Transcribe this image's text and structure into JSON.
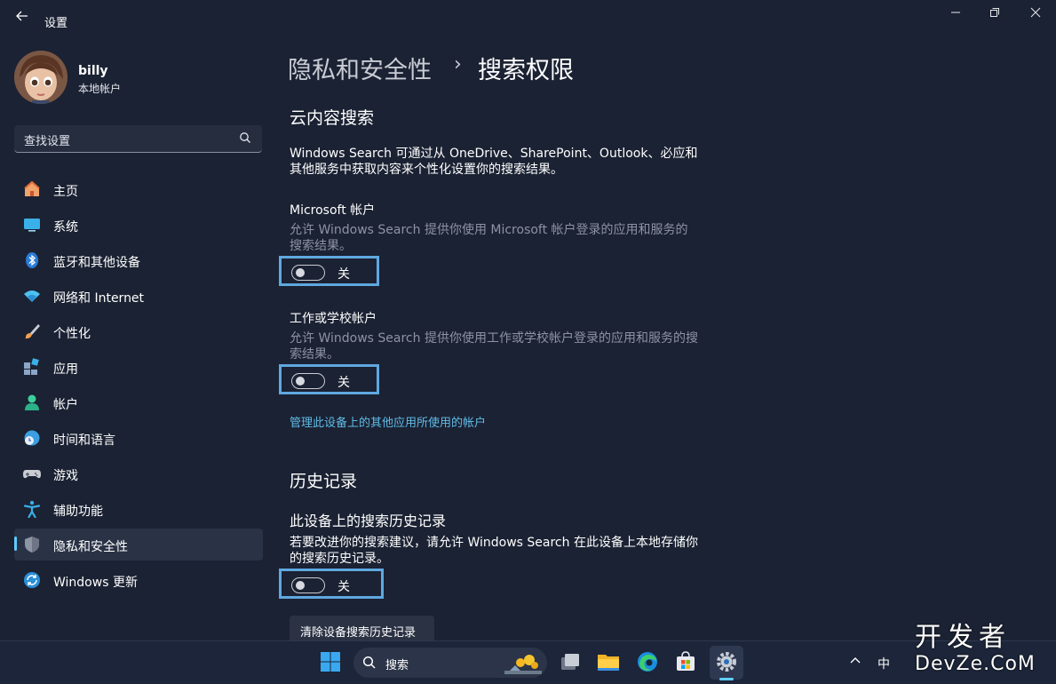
{
  "window": {
    "title": "设置"
  },
  "user": {
    "name": "billy",
    "account_type": "本地帐户"
  },
  "search": {
    "placeholder": "查找设置"
  },
  "nav": [
    {
      "id": "home",
      "label": "主页",
      "icon": "home-icon"
    },
    {
      "id": "system",
      "label": "系统",
      "icon": "display-icon"
    },
    {
      "id": "bluetooth",
      "label": "蓝牙和其他设备",
      "icon": "bluetooth-icon"
    },
    {
      "id": "network",
      "label": "网络和 Internet",
      "icon": "wifi-icon"
    },
    {
      "id": "personalization",
      "label": "个性化",
      "icon": "brush-icon"
    },
    {
      "id": "apps",
      "label": "应用",
      "icon": "apps-icon"
    },
    {
      "id": "accounts",
      "label": "帐户",
      "icon": "person-icon"
    },
    {
      "id": "time",
      "label": "时间和语言",
      "icon": "globe-clock-icon"
    },
    {
      "id": "gaming",
      "label": "游戏",
      "icon": "gamepad-icon"
    },
    {
      "id": "accessibility",
      "label": "辅助功能",
      "icon": "accessibility-icon"
    },
    {
      "id": "privacy",
      "label": "隐私和安全性",
      "icon": "shield-icon",
      "active": true
    },
    {
      "id": "update",
      "label": "Windows 更新",
      "icon": "update-icon"
    }
  ],
  "breadcrumb": {
    "parent": "隐私和安全性",
    "separator": "›",
    "current": "搜索权限"
  },
  "cloud": {
    "title": "云内容搜索",
    "description": "Windows Search 可通过从 OneDrive、SharePoint、Outlook、必应和其他服务中获取内容来个性化设置你的搜索结果。",
    "microsoft": {
      "title": "Microsoft 帐户",
      "description": "允许 Windows Search 提供你使用 Microsoft 帐户登录的应用和服务的搜索结果。",
      "toggle": {
        "state_label": "关",
        "on": false
      }
    },
    "work": {
      "title": "工作或学校帐户",
      "description": "允许 Windows Search 提供你使用工作或学校帐户登录的应用和服务的搜索结果。",
      "toggle": {
        "state_label": "关",
        "on": false
      }
    },
    "manage_link": "管理此设备上的其他应用所使用的帐户"
  },
  "history": {
    "title": "历史记录",
    "device": {
      "title": "此设备上的搜索历史记录",
      "description": "若要改进你的搜索建议，请允许 Windows Search 在此设备上本地存储你的搜索历史记录。",
      "toggle": {
        "state_label": "关",
        "on": false
      }
    },
    "clear_button": "清除设备搜索历史记录"
  },
  "taskbar": {
    "search_placeholder": "搜索",
    "tray_ime": "中"
  },
  "watermark": {
    "line1": "开发者",
    "line2": "DevZe.CoM"
  },
  "colors": {
    "accent": "#60cdff",
    "highlight_box": "#5fa8e0",
    "background": "#1b2233"
  }
}
